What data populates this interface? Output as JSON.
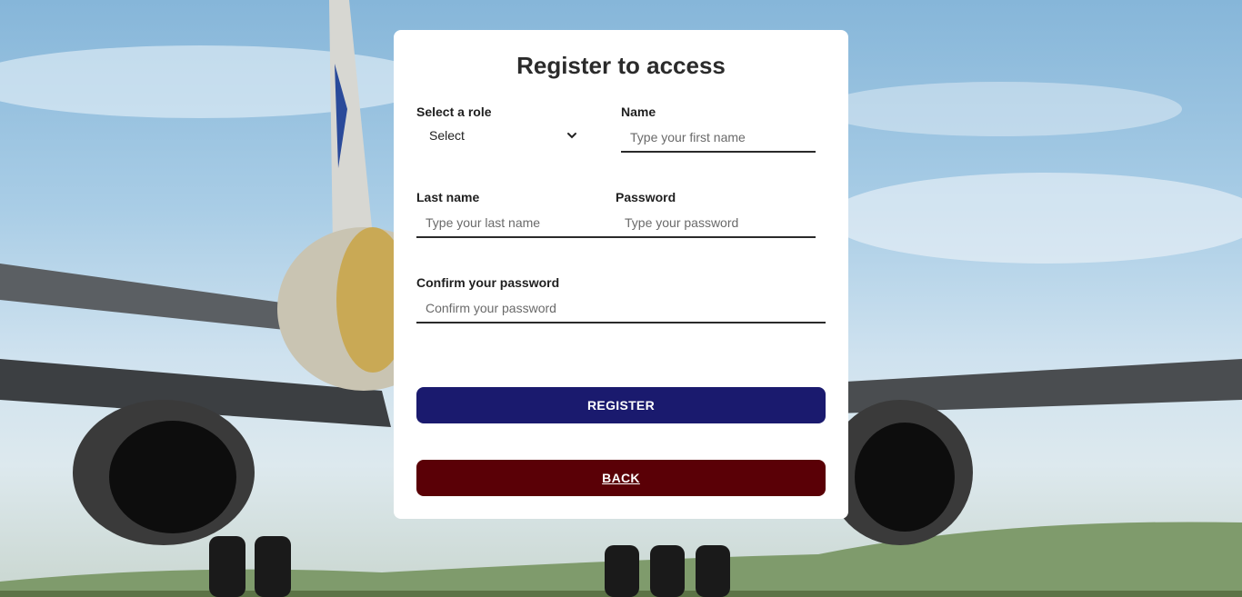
{
  "form": {
    "title": "Register to access",
    "role": {
      "label": "Select a role",
      "value": "Select"
    },
    "name": {
      "label": "Name",
      "placeholder": "Type your first name"
    },
    "last_name": {
      "label": "Last name",
      "placeholder": "Type your last name"
    },
    "password": {
      "label": "Password",
      "placeholder": "Type your password"
    },
    "confirm": {
      "label": "Confirm your password",
      "placeholder": "Confirm your password"
    },
    "register_label": "REGISTER",
    "back_label": "BACK"
  },
  "colors": {
    "register_button": "#1a1a6e",
    "back_button": "#5a0006",
    "card": "#ffffff"
  }
}
